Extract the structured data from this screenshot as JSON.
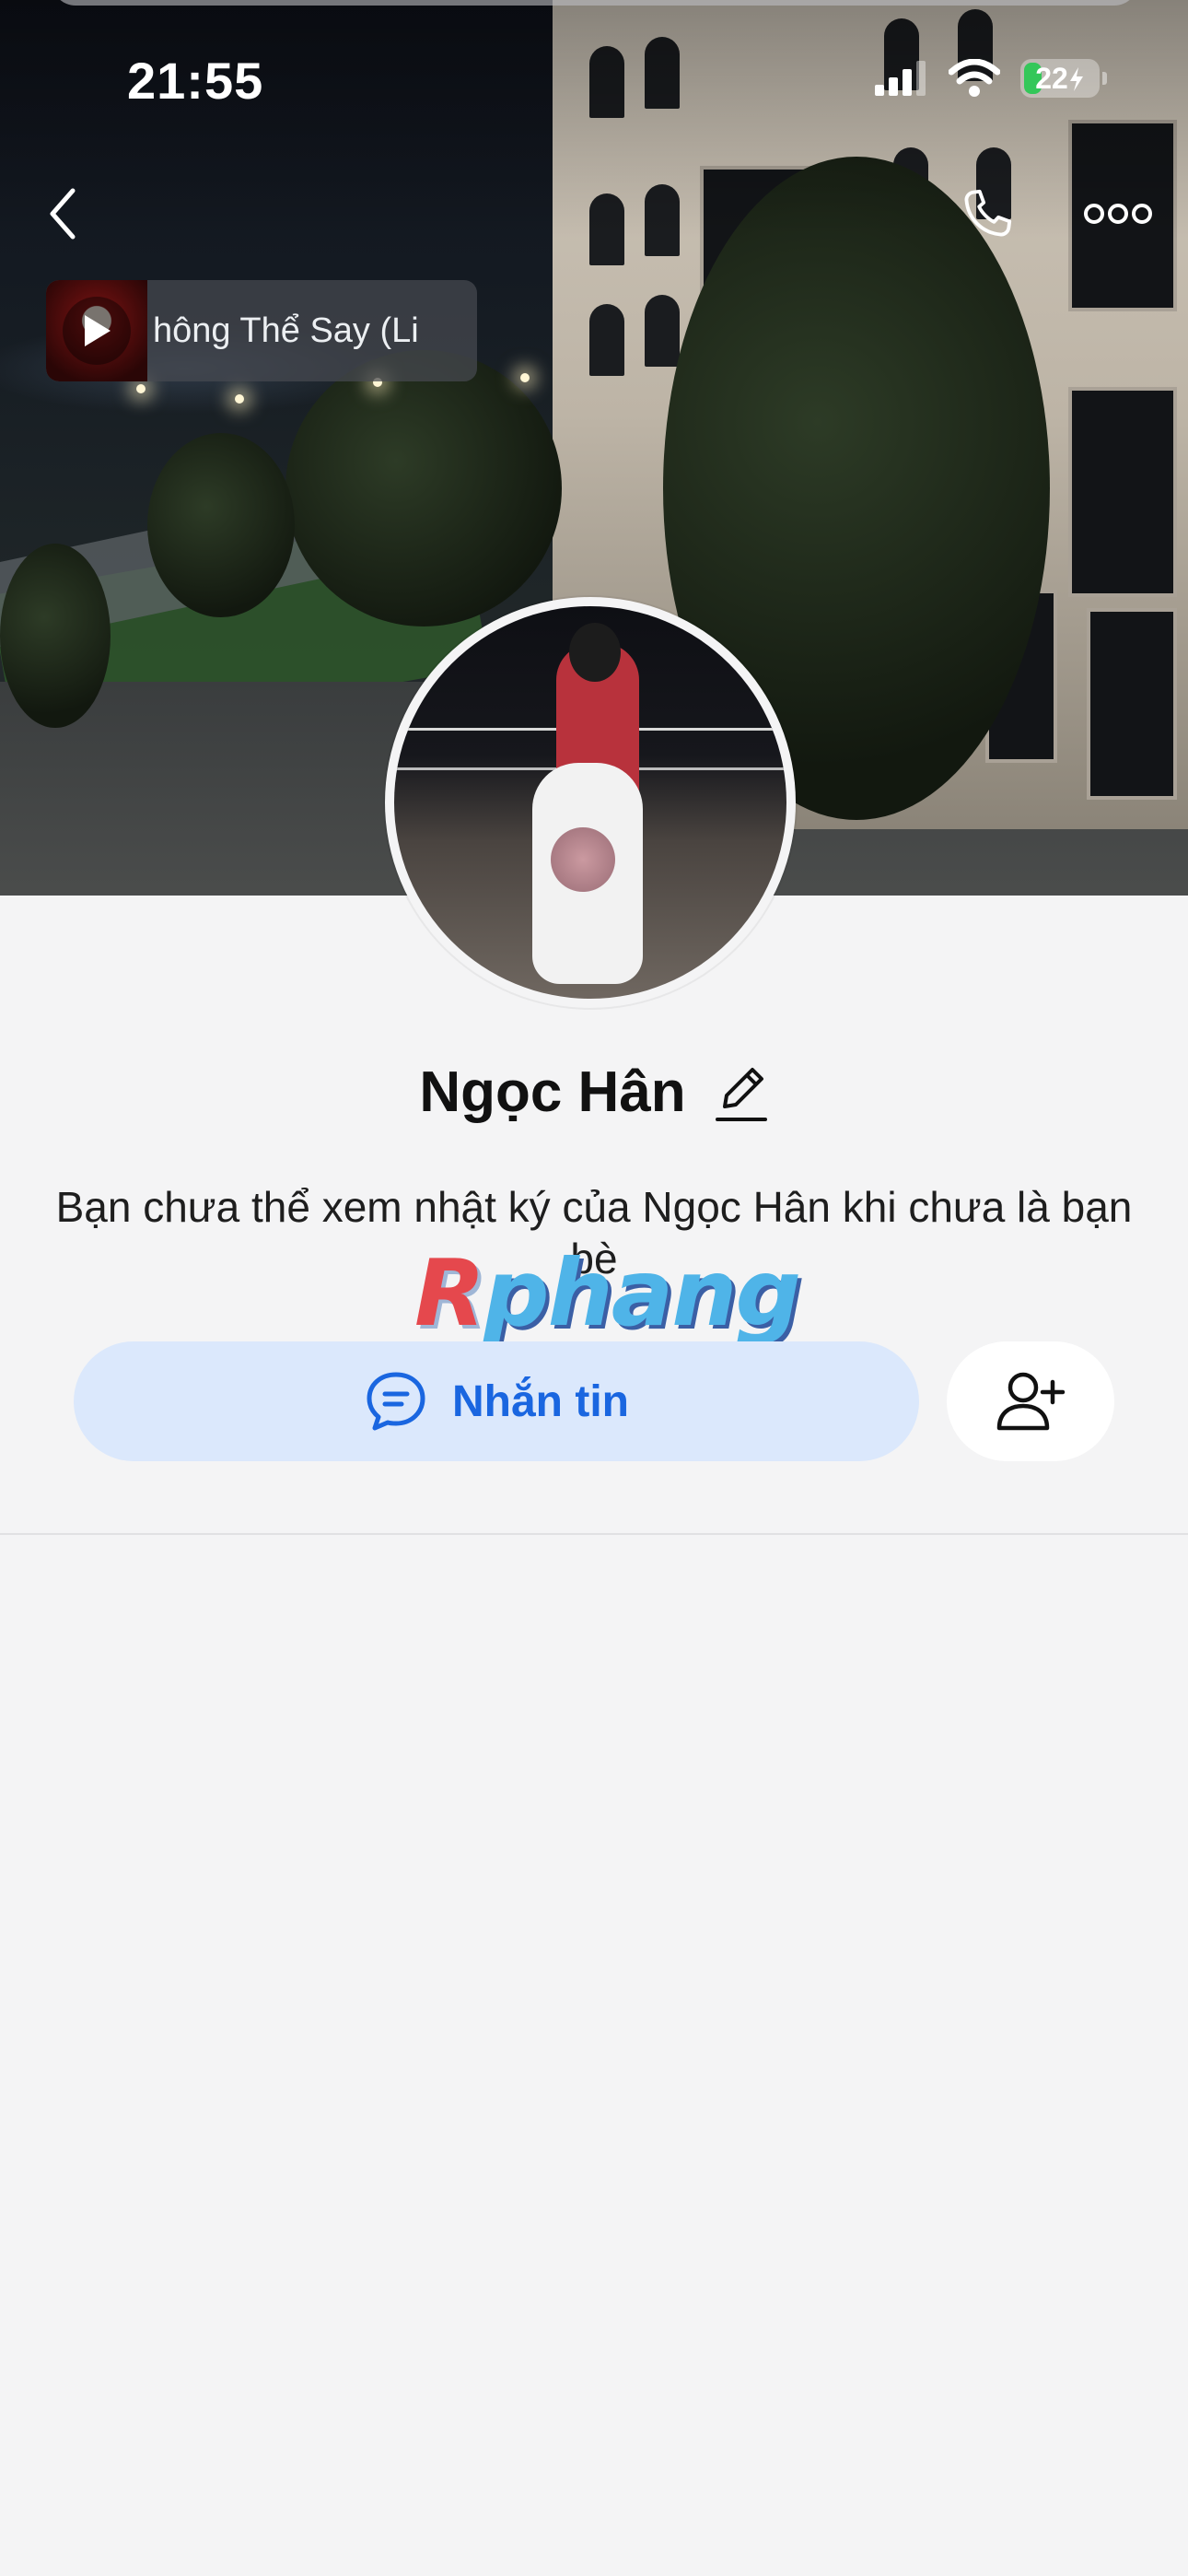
{
  "status_bar": {
    "time": "21:55",
    "battery": "22"
  },
  "music": {
    "title": "hông Thể Say (Li"
  },
  "profile": {
    "name": "Ngọc Hân",
    "privacy_note": "Bạn chưa thể xem nhật ký của Ngọc Hân khi chưa là bạn bè"
  },
  "actions": {
    "message_label": "Nhắn tin"
  },
  "watermark": {
    "first": "R",
    "rest": "phang"
  },
  "colors": {
    "accent": "#1a66e0",
    "message_button_bg": "#dbe8fc",
    "battery_fill": "#34c759"
  },
  "icons": [
    "back-icon",
    "phone-icon",
    "more-icon",
    "play-icon",
    "edit-icon",
    "chat-icon",
    "add-friend-icon",
    "signal-icon",
    "wifi-icon",
    "bolt-icon"
  ]
}
